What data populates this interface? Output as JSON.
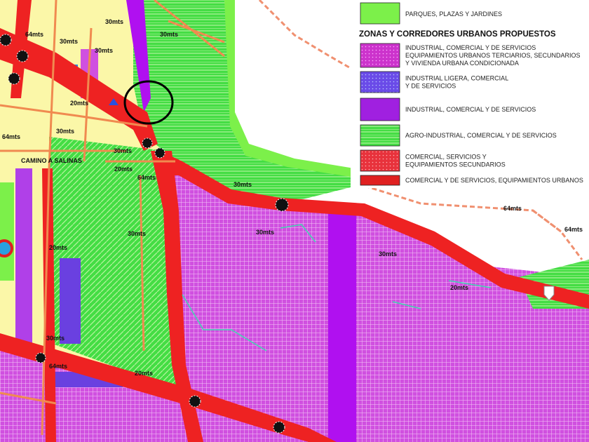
{
  "legend": {
    "parks_label": "PARQUES, PLAZAS Y JARDINES",
    "title": "ZONAS Y CORREDORES URBANOS PROPUESTOS",
    "items": [
      {
        "lines": [
          "INDUSTRIAL, COMERCIAL Y DE SERVICIOS",
          "EQUIPAMIENTOS URBANOS TERCIARIOS, SECUNDARIOS",
          "Y VIVIENDA URBANA CONDICIONADA"
        ],
        "color": "#cc33cc"
      },
      {
        "lines": [
          "INDUSTRIAL LIGERA, COMERCIAL",
          "Y DE SERVICIOS"
        ],
        "color": "#6a4be8"
      },
      {
        "lines": [
          "INDUSTRIAL, COMERCIAL Y DE SERVICIOS"
        ],
        "color": "#a020e0"
      },
      {
        "lines": [
          "AGRO-INDUSTRIAL, COMERCIAL Y DE SERVICIOS"
        ],
        "color": "#33cc33"
      },
      {
        "lines": [
          "COMERCIAL, SERVICIOS Y",
          "EQUIPAMIENTOS SECUNDARIOS"
        ],
        "color": "#e8323c"
      },
      {
        "lines": [
          "COMERCIAL Y DE SERVICIOS, EQUIPAMIENTOS URBANOS"
        ],
        "color": "#e02020"
      }
    ]
  },
  "colors": {
    "park_green": "#7cf04a",
    "agro_green": "#33dd33",
    "magenta": "#d050e0",
    "purple": "#a018f0",
    "blue_violet": "#6a40e0",
    "red_corridor": "#ee2222",
    "orange_road": "#f08a50",
    "yellow_base": "#fbf7a8"
  },
  "road_widths": [
    "30mts",
    "30mts",
    "30mts",
    "30mts",
    "20mts",
    "64mts",
    "20mts",
    "30mts",
    "30mts",
    "64mts",
    "64mts",
    "30mts",
    "20mts",
    "30mts",
    "30mts",
    "20mts",
    "64mts",
    "30mts",
    "30mts",
    "64mts",
    "64mts",
    "20mts"
  ],
  "street_labels": [
    "CAMINO A SALINAS"
  ]
}
